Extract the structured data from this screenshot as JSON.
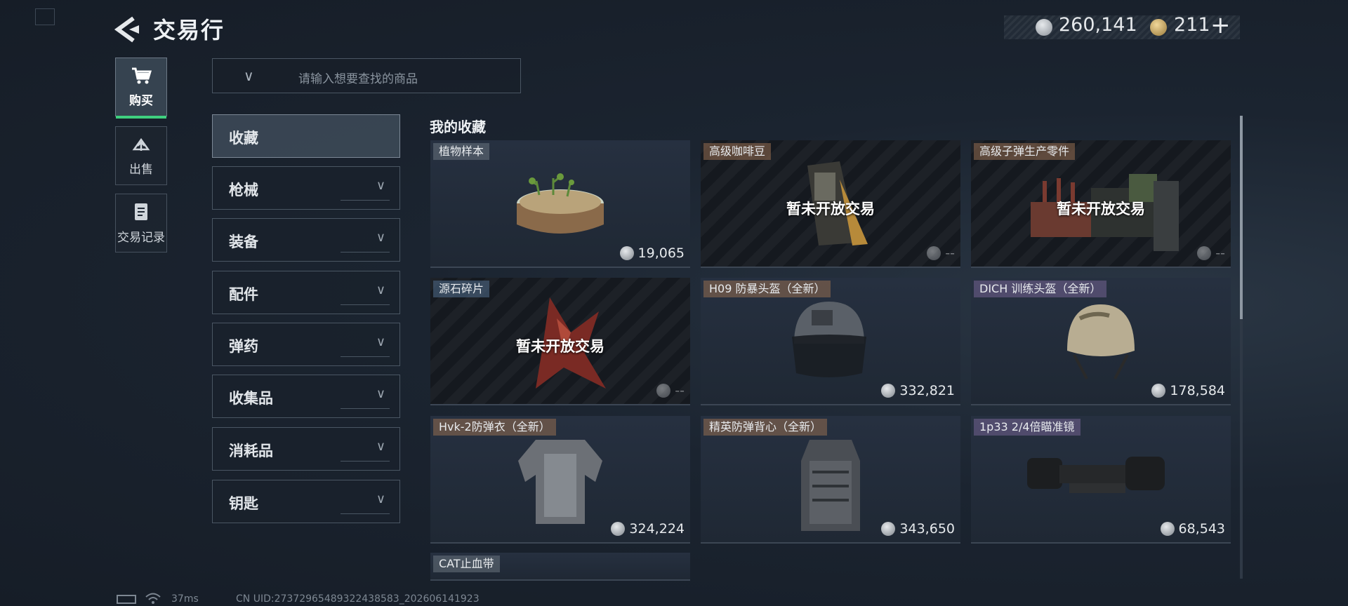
{
  "header": {
    "title": "交易行",
    "silver_amount": "260,141",
    "gold_amount": "211",
    "plus_label": "+"
  },
  "tabs": [
    {
      "label": "购买",
      "icon": "cart-icon",
      "active": true
    },
    {
      "label": "出售",
      "icon": "sell-icon",
      "active": false
    },
    {
      "label": "交易记录",
      "icon": "record-icon",
      "active": false
    }
  ],
  "search": {
    "placeholder": "请输入想要查找的商品"
  },
  "categories": [
    {
      "label": "收藏",
      "active": true
    },
    {
      "label": "枪械"
    },
    {
      "label": "装备"
    },
    {
      "label": "配件"
    },
    {
      "label": "弹药"
    },
    {
      "label": "收集品"
    },
    {
      "label": "消耗品"
    },
    {
      "label": "钥匙"
    }
  ],
  "section_title": "我的收藏",
  "items": [
    {
      "name": "植物样本",
      "price": "19,065",
      "locked": false
    },
    {
      "name": "高级咖啡豆",
      "price": "--",
      "locked": true,
      "locked_text": "暂未开放交易"
    },
    {
      "name": "高级子弹生产零件",
      "price": "--",
      "locked": true,
      "locked_text": "暂未开放交易"
    },
    {
      "name": "源石碎片",
      "price": "--",
      "locked": true,
      "locked_text": "暂未开放交易"
    },
    {
      "name": "H09 防暴头盔（全新）",
      "price": "332,821",
      "locked": false
    },
    {
      "name": "DICH 训练头盔（全新）",
      "price": "178,584",
      "locked": false
    },
    {
      "name": "Hvk-2防弹衣（全新）",
      "price": "324,224",
      "locked": false
    },
    {
      "name": "精英防弹背心（全新）",
      "price": "343,650",
      "locked": false
    },
    {
      "name": "1p33 2/4倍瞄准镜",
      "price": "68,543",
      "locked": false
    },
    {
      "name": "CAT止血带",
      "price": "",
      "locked": false
    }
  ],
  "footer": {
    "ping": "37ms",
    "uid": "CN UID:27372965489322438583_202606141923"
  },
  "colors": {
    "active_tab_accent": "#3fd07f",
    "background": "#1b2430"
  }
}
